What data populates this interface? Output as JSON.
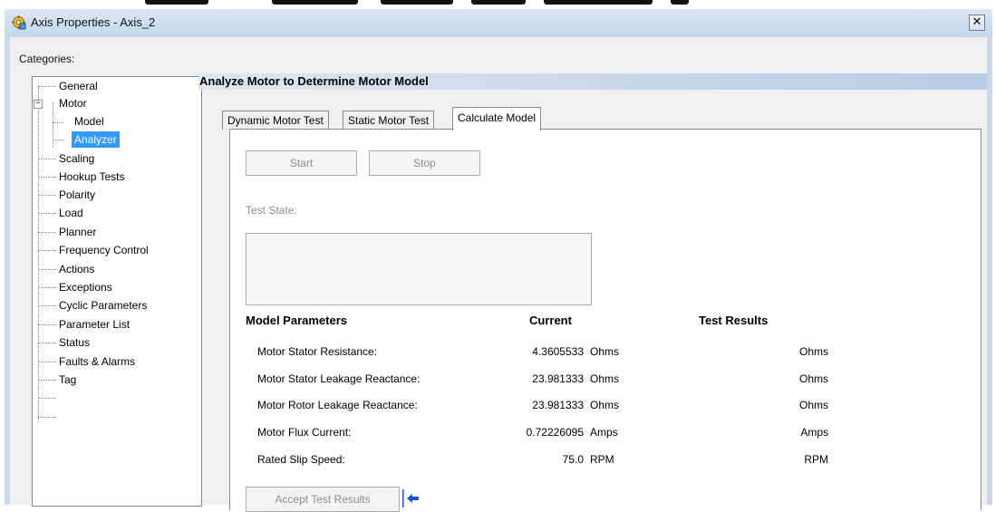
{
  "window": {
    "title": "Axis Properties - Axis_2",
    "close_glyph": "✕",
    "icon": "axis-properties-icon"
  },
  "categories_label": "Categories:",
  "tree": {
    "items": [
      {
        "label": "General",
        "selected": false
      },
      {
        "label": "Motor",
        "selected": false,
        "expanded": true
      },
      {
        "label": "Model",
        "selected": false
      },
      {
        "label": "Analyzer",
        "selected": true
      },
      {
        "label": "Scaling",
        "selected": false
      },
      {
        "label": "Hookup Tests",
        "selected": false
      },
      {
        "label": "Polarity",
        "selected": false
      },
      {
        "label": "Load",
        "selected": false
      },
      {
        "label": "Planner",
        "selected": false
      },
      {
        "label": "Frequency Control",
        "selected": false
      },
      {
        "label": "Actions",
        "selected": false
      },
      {
        "label": "Exceptions",
        "selected": false
      },
      {
        "label": "Cyclic Parameters",
        "selected": false
      },
      {
        "label": "Parameter List",
        "selected": false
      },
      {
        "label": "Status",
        "selected": false
      },
      {
        "label": "Faults & Alarms",
        "selected": false
      },
      {
        "label": "Tag",
        "selected": false
      }
    ],
    "expander_glyph": "−"
  },
  "section_title": "Analyze Motor to Determine Motor Model",
  "tabs": [
    {
      "label": "Dynamic Motor Test",
      "active": false
    },
    {
      "label": "Static Motor Test",
      "active": false
    },
    {
      "label": "Calculate Model",
      "active": true
    }
  ],
  "buttons": {
    "start": "Start",
    "stop": "Stop",
    "accept": "Accept Test Results"
  },
  "test_state_label": "Test State:",
  "table": {
    "headers": {
      "params": "Model Parameters",
      "current": "Current",
      "results": "Test Results"
    },
    "rows": [
      {
        "label": "Motor Stator Resistance:",
        "value": "4.3605533",
        "unit": "Ohms",
        "result_unit": "Ohms"
      },
      {
        "label": "Motor Stator Leakage Reactance:",
        "value": "23.981333",
        "unit": "Ohms",
        "result_unit": "Ohms"
      },
      {
        "label": "Motor Rotor Leakage Reactance:",
        "value": "23.981333",
        "unit": "Ohms",
        "result_unit": "Ohms"
      },
      {
        "label": "Motor Flux Current:",
        "value": "0.72226095",
        "unit": "Amps",
        "result_unit": "Amps"
      },
      {
        "label": "Rated Slip Speed:",
        "value": "75.0",
        "unit": "RPM",
        "result_unit": "RPM"
      }
    ]
  },
  "colors": {
    "selection": "#3399ff",
    "pointer_arrow": "#1f4fd6"
  }
}
